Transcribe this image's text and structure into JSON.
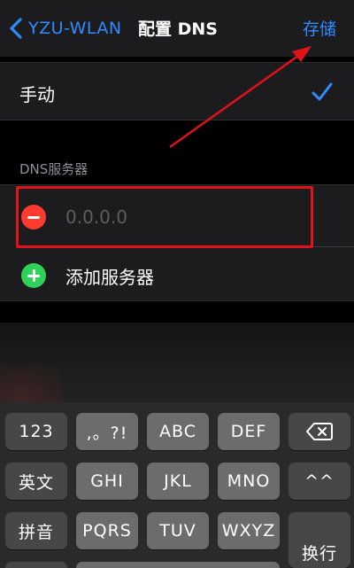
{
  "navbar": {
    "back_label": "YZU-WLAN",
    "title": "配置 DNS",
    "save_label": "存储"
  },
  "option": {
    "label": "手动",
    "selected": true
  },
  "section_header": "DNS服务器",
  "server": {
    "placeholder": "0.0.0.0",
    "value": ""
  },
  "add_server_label": "添加服务器",
  "colors": {
    "accent": "#2f8cff",
    "delete": "#ff3b30",
    "add": "#30d158",
    "annotation": "#e0121a"
  },
  "keyboard": {
    "row1": [
      "123",
      ",。?!",
      "ABC",
      "DEF",
      "delete"
    ],
    "row2": [
      "英文",
      "GHI",
      "JKL",
      "MNO",
      "^^"
    ],
    "row3": [
      "拼音",
      "PQRS",
      "TUV",
      "WXYZ",
      "换行"
    ]
  }
}
